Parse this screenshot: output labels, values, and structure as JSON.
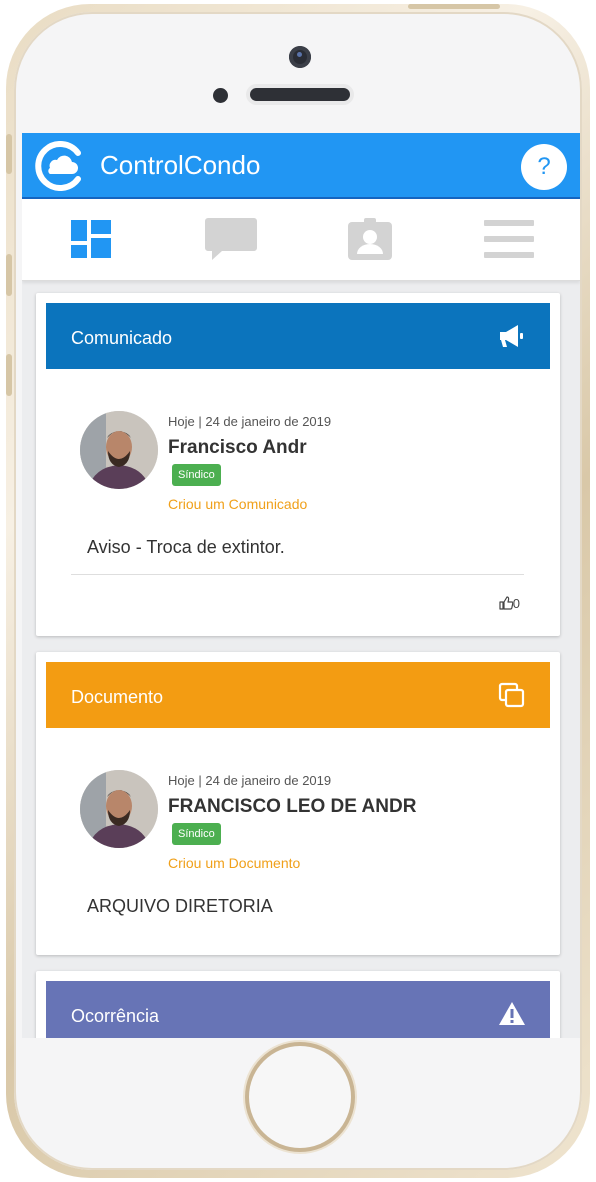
{
  "app": {
    "title": "ControlCondo",
    "help_label": "?",
    "accent_color": "#2196f3"
  },
  "nav": {
    "items": [
      {
        "icon": "dashboard-icon",
        "active": true
      },
      {
        "icon": "chat-icon",
        "active": false
      },
      {
        "icon": "contact-card-icon",
        "active": false
      },
      {
        "icon": "menu-icon",
        "active": false
      }
    ]
  },
  "feed": {
    "cards": [
      {
        "type": "Comunicado",
        "header_color": "#0b74bd",
        "icon": "megaphone-icon",
        "date": "Hoje | 24 de janeiro de 2019",
        "author": "Francisco Andr",
        "role": "Síndico",
        "action": "Criou um Comunicado",
        "text": "Aviso - Troca de extintor.",
        "likes": "0"
      },
      {
        "type": "Documento",
        "header_color": "#f39c12",
        "icon": "documents-icon",
        "date": "Hoje | 24 de janeiro de 2019",
        "author": "FRANCISCO LEO DE ANDR",
        "role": "Síndico",
        "action": "Criou um Documento",
        "text": "ARQUIVO DIRETORIA"
      },
      {
        "type": "Ocorrência",
        "header_color": "#6774b6",
        "icon": "warning-icon"
      }
    ]
  }
}
